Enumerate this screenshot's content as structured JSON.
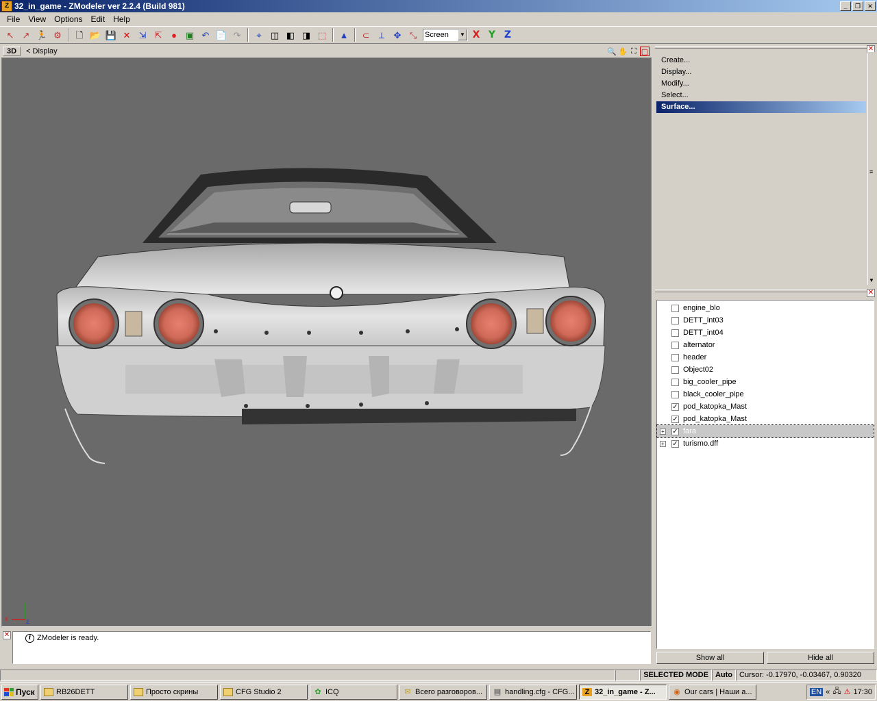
{
  "window": {
    "title": "32_in_game - ZModeler ver 2.2.4 (Build 981)",
    "app_icon": "Z"
  },
  "menu": [
    "File",
    "View",
    "Options",
    "Edit",
    "Help"
  ],
  "toolbar": {
    "coord_select": "Screen",
    "axis_x": "X",
    "axis_y": "Y",
    "axis_z": "Z"
  },
  "viewport": {
    "mode": "3D",
    "label": "<  Display",
    "axis_x": "x",
    "axis_z": "z",
    "background": "#6a6a6a"
  },
  "log": {
    "message": "ZModeler is ready."
  },
  "command_panel": {
    "items": [
      "Create...",
      "Display...",
      "Modify...",
      "Select...",
      "Surface..."
    ],
    "active_index": 4
  },
  "object_panel": {
    "items": [
      {
        "label": "engine_blo",
        "checked": false,
        "expandable": false
      },
      {
        "label": "DETT_int03",
        "checked": false,
        "expandable": false
      },
      {
        "label": "DETT_int04",
        "checked": false,
        "expandable": false
      },
      {
        "label": "alternator",
        "checked": false,
        "expandable": false
      },
      {
        "label": "header",
        "checked": false,
        "expandable": false
      },
      {
        "label": "Object02",
        "checked": false,
        "expandable": false
      },
      {
        "label": "big_cooler_pipe",
        "checked": false,
        "expandable": false
      },
      {
        "label": "black_cooler_pipe",
        "checked": false,
        "expandable": false
      },
      {
        "label": "pod_katopka_Mast",
        "checked": true,
        "expandable": false
      },
      {
        "label": "pod_katopka_Mast",
        "checked": true,
        "expandable": false
      },
      {
        "label": "fara",
        "checked": true,
        "expandable": true,
        "selected": true
      },
      {
        "label": "turismo.dff",
        "checked": true,
        "expandable": true
      }
    ],
    "show_all": "Show all",
    "hide_all": "Hide all"
  },
  "statusbar": {
    "mode": "SELECTED MODE",
    "snap": "Auto",
    "cursor": "Cursor: -0.17970, -0.03467, 0.90320"
  },
  "taskbar": {
    "start": "Пуск",
    "tasks": [
      {
        "label": "RB26DETT",
        "icon": "folder-icon"
      },
      {
        "label": "Просто скрины",
        "icon": "folder-icon"
      },
      {
        "label": "CFG Studio 2",
        "icon": "folder-icon"
      },
      {
        "label": "ICQ",
        "icon": "icq-icon"
      },
      {
        "label": "Всего разговоров...",
        "icon": "chat-icon"
      },
      {
        "label": "handling.cfg - CFG...",
        "icon": "cfg-icon"
      },
      {
        "label": "32_in_game - Z...",
        "icon": "zmodeler-icon",
        "active": true
      },
      {
        "label": "Our cars | Наши а...",
        "icon": "firefox-icon"
      }
    ],
    "tray_lang": "EN",
    "clock": "17:30"
  }
}
